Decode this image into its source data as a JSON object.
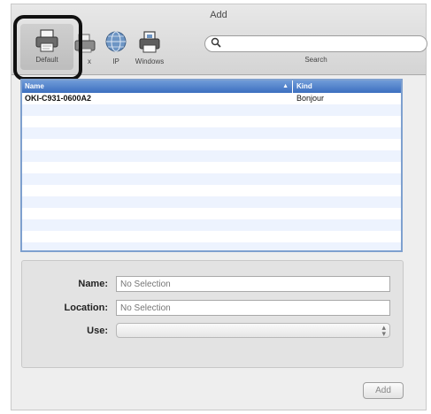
{
  "window": {
    "title": "Add"
  },
  "toolbar": {
    "items": [
      {
        "label": "Default",
        "icon": "printer-icon"
      },
      {
        "label": "Fax",
        "icon": "fax-icon"
      },
      {
        "label": "IP",
        "icon": "globe-icon"
      },
      {
        "label": "Windows",
        "icon": "windows-printer-icon"
      }
    ],
    "search": {
      "label": "Search",
      "value": ""
    }
  },
  "list": {
    "columns": {
      "name": "Name",
      "kind": "Kind"
    },
    "rows": [
      {
        "name": "OKI-C931-0600A2",
        "kind": "Bonjour"
      }
    ]
  },
  "details": {
    "name_label": "Name:",
    "name_placeholder": "No Selection",
    "location_label": "Location:",
    "location_placeholder": "No Selection",
    "use_label": "Use:",
    "use_value": ""
  },
  "actions": {
    "add_label": "Add"
  },
  "colors": {
    "highlight": "#111111",
    "list_header": "#3c6fc0",
    "row_alt": "#edf3fe"
  }
}
